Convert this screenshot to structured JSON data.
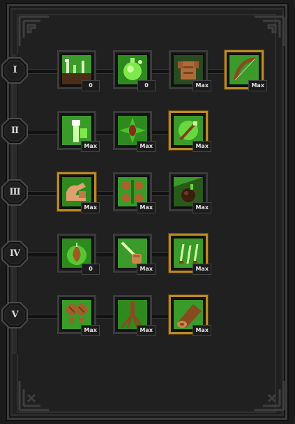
{
  "tiers": [
    {
      "numeral": "I",
      "skills": [
        {
          "icon": "grass-sprout-icon",
          "level": "0",
          "maxed": false
        },
        {
          "icon": "green-flask-icon",
          "level": "0",
          "maxed": false
        },
        {
          "icon": "leather-armor-icon",
          "level": "Max",
          "maxed": false
        },
        {
          "icon": "bow-icon",
          "level": "Max",
          "maxed": true
        }
      ]
    },
    {
      "numeral": "II",
      "skills": [
        {
          "icon": "arrow-shot-icon",
          "level": "Max",
          "maxed": false
        },
        {
          "icon": "seed-burst-icon",
          "level": "Max",
          "maxed": false
        },
        {
          "icon": "thorn-arrow-icon",
          "level": "Max",
          "maxed": true
        }
      ]
    },
    {
      "numeral": "III",
      "skills": [
        {
          "icon": "flexed-arm-icon",
          "level": "Max",
          "maxed": true
        },
        {
          "icon": "fruit-cluster-icon",
          "level": "Max",
          "maxed": false
        },
        {
          "icon": "seed-bomb-icon",
          "level": "Max",
          "maxed": false
        }
      ]
    },
    {
      "numeral": "IV",
      "skills": [
        {
          "icon": "seed-drop-icon",
          "level": "0",
          "maxed": false
        },
        {
          "icon": "fist-strike-icon",
          "level": "Max",
          "maxed": false
        },
        {
          "icon": "arrow-rain-icon",
          "level": "Max",
          "maxed": true
        }
      ]
    },
    {
      "numeral": "V",
      "skills": [
        {
          "icon": "nut-cluster-icon",
          "level": "Max",
          "maxed": false
        },
        {
          "icon": "tree-roots-icon",
          "level": "Max",
          "maxed": false
        },
        {
          "icon": "log-icon",
          "level": "Max",
          "maxed": true
        }
      ]
    }
  ],
  "colors": {
    "gold_border": "#b88a2a",
    "leaf_green": "#5fd63a",
    "panel_bg": "#202020"
  }
}
